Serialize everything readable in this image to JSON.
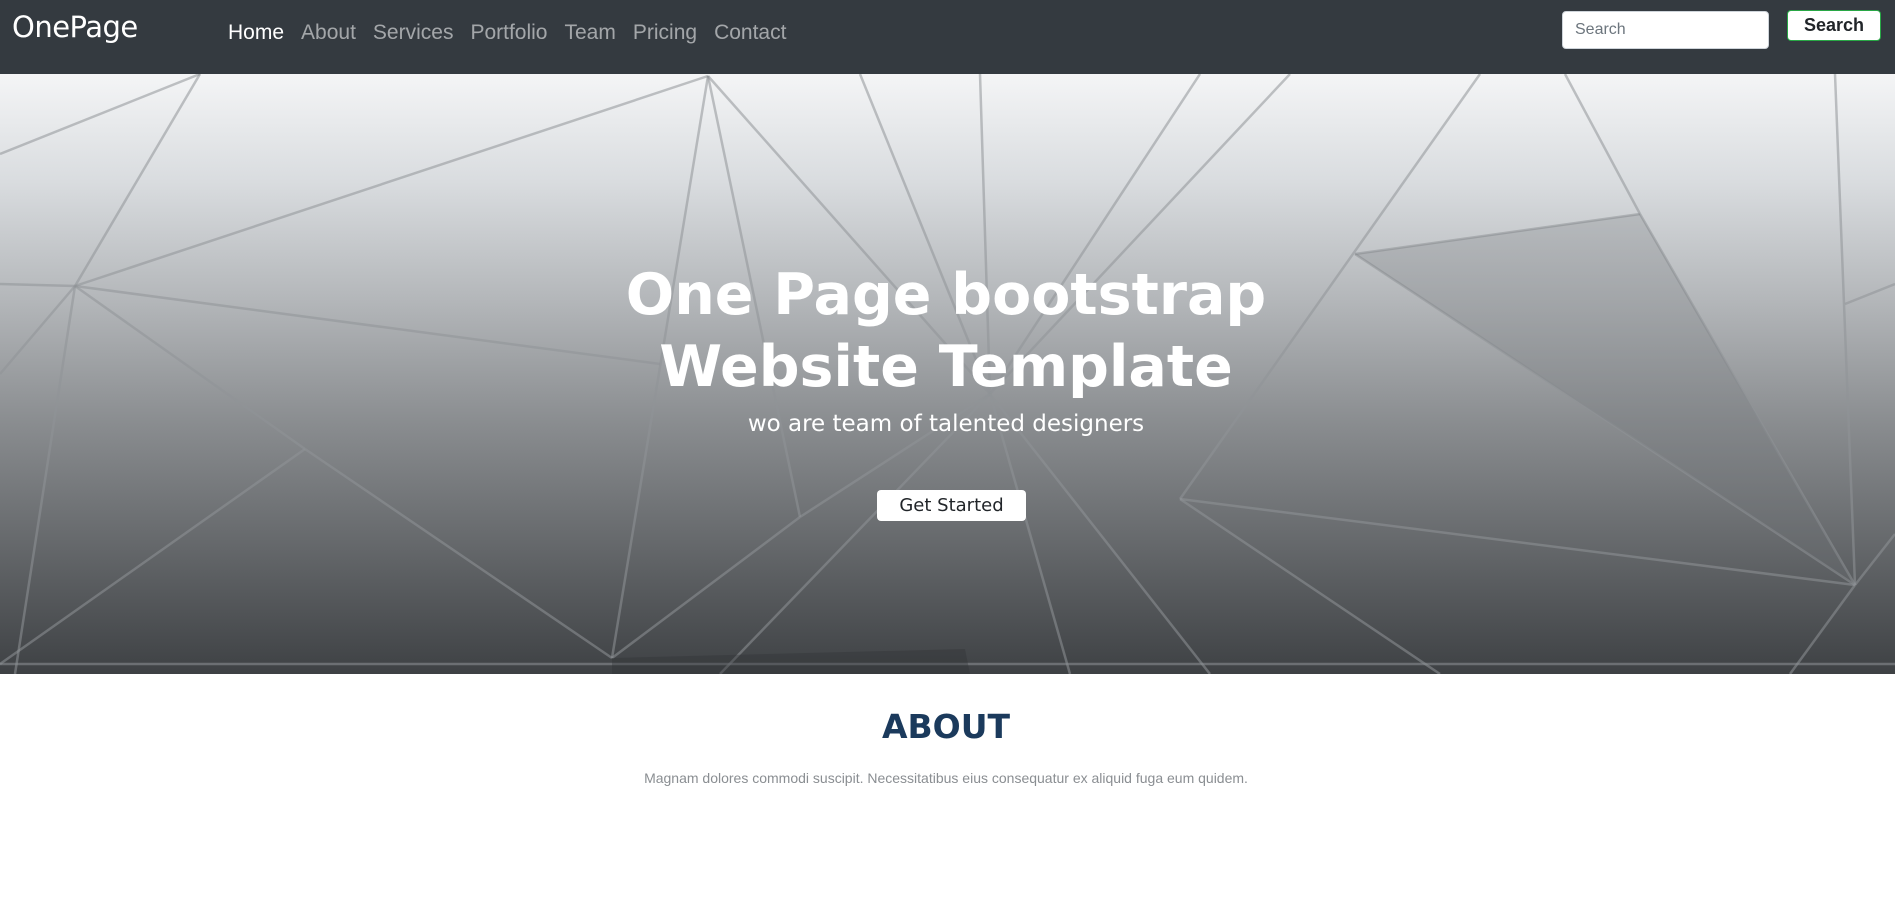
{
  "navbar": {
    "brand": "OnePage",
    "links": [
      {
        "label": "Home",
        "active": true
      },
      {
        "label": "About",
        "active": false
      },
      {
        "label": "Services",
        "active": false
      },
      {
        "label": "Portfolio",
        "active": false
      },
      {
        "label": "Team",
        "active": false
      },
      {
        "label": "Pricing",
        "active": false
      },
      {
        "label": "Contact",
        "active": false
      }
    ],
    "search_placeholder": "Search",
    "search_value": "",
    "search_button_label": "Search"
  },
  "hero": {
    "title_line1": "One Page bootstrap",
    "title_line2": "Website Template",
    "subtitle": "wo are team of talented designers",
    "cta_label": "Get Started"
  },
  "about": {
    "title": "ABOUT",
    "text": "Magnam dolores commodi suscipit. Necessitatibus eius consequatur ex aliquid fuga eum quidem."
  },
  "colors": {
    "navbar_bg": "#343a40",
    "search_button_border": "#28a745",
    "about_title": "#1b3a5c"
  }
}
